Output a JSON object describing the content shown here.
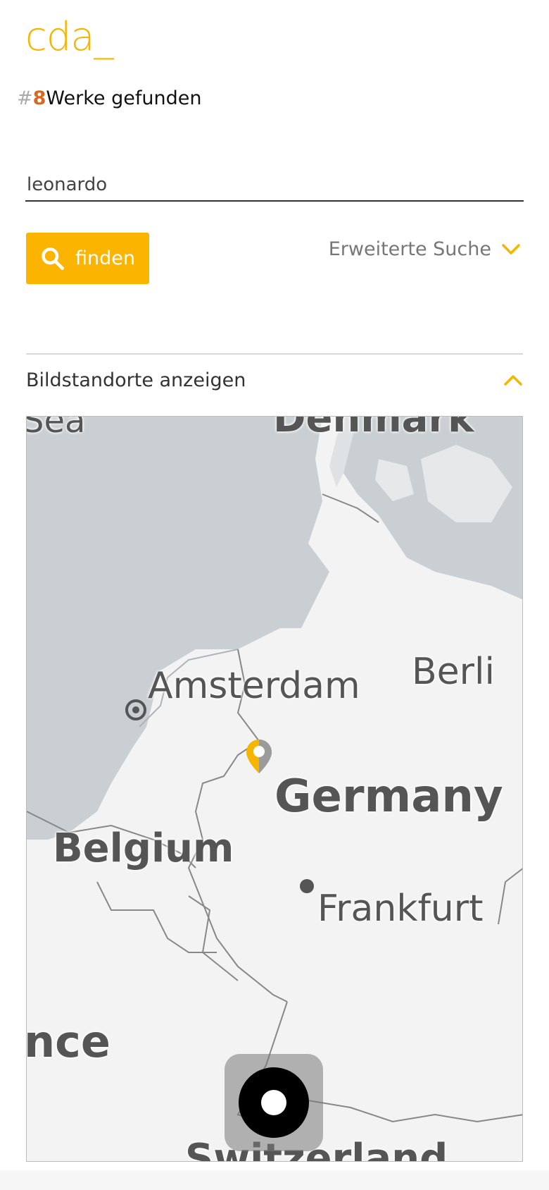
{
  "app": {
    "logo": "cda_"
  },
  "results": {
    "hash": "#",
    "count": "8",
    "label": "Werke gefunden"
  },
  "search": {
    "value": "leonardo",
    "button_label": "finden"
  },
  "advanced": {
    "label": "Erweiterte Suche"
  },
  "map_section": {
    "toggle_label": "Bildstandorte anzeigen"
  },
  "map": {
    "labels": {
      "sea": "Sea",
      "denmark": "Denmark",
      "amsterdam": "Amsterdam",
      "berlin": "Berli",
      "germany": "Germany",
      "belgium": "Belgium",
      "frankfurt": "Frankfurt",
      "france": "nce",
      "switzerland": "Switzerland"
    },
    "marker_color": "#f7b500"
  },
  "colors": {
    "accent": "#fbb400",
    "count": "#d9681e",
    "water": "#c9cfd2",
    "land": "#f3f3f3"
  }
}
